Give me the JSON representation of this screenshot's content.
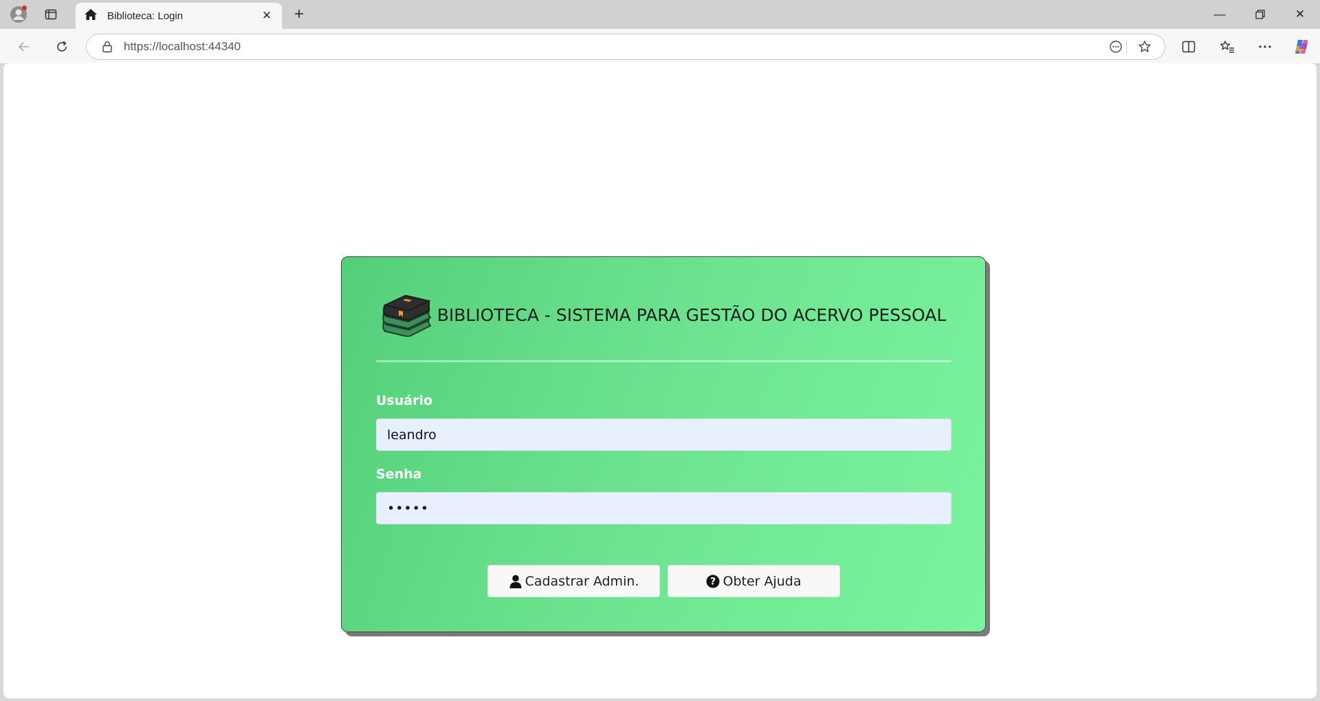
{
  "browser": {
    "tab": {
      "title": "Biblioteca: Login",
      "icon": "home-icon"
    },
    "address": {
      "url": "https://localhost:44340"
    },
    "colors": {
      "tabbar": "#d1d1d1",
      "toolbar": "#f7f7f7"
    }
  },
  "page": {
    "header": {
      "title": "BIBLIOTECA - SISTEMA PARA GESTÃO DO ACERVO PESSOAL",
      "logo_icon": "books-stack-icon"
    },
    "form": {
      "username": {
        "label": "Usuário",
        "value": "leandro"
      },
      "password": {
        "label": "Senha",
        "value": "•••••"
      }
    },
    "buttons": {
      "register": {
        "label": "Cadastrar Admin.",
        "icon": "user-icon"
      },
      "help": {
        "label": "Obter Ajuda",
        "icon": "question-circle-icon"
      }
    },
    "colors": {
      "card_start": "#54cf79",
      "card_end": "#7bf49e",
      "input_bg": "#e8f0fe"
    }
  }
}
